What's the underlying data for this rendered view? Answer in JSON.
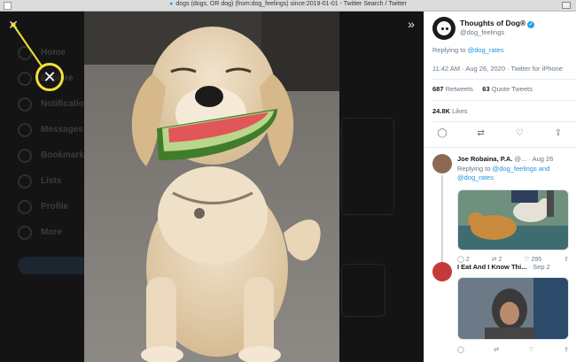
{
  "browser": {
    "tab_title": "dogs (dogs, OR dog) (from:dog_feelings) since:2019-01-01 - Twitter Search / Twitter"
  },
  "background_nav": {
    "items": [
      {
        "label": "Home",
        "icon": "home-icon"
      },
      {
        "label": "Explore",
        "icon": "hashtag-icon"
      },
      {
        "label": "Notifications",
        "icon": "bell-icon"
      },
      {
        "label": "Messages",
        "icon": "mail-icon"
      },
      {
        "label": "Bookmarks",
        "icon": "bookmark-icon"
      },
      {
        "label": "Lists",
        "icon": "list-icon"
      },
      {
        "label": "Profile",
        "icon": "user-icon"
      },
      {
        "label": "More",
        "icon": "more-icon"
      }
    ]
  },
  "viewer": {
    "close_glyph": "✕",
    "next_glyph": "»",
    "callout_glyph": "✕",
    "callout_color": "#f2e135"
  },
  "tweet": {
    "author_name": "Thoughts of Dog®",
    "author_handle": "@dog_feelings",
    "replying_prefix": "Replying to",
    "replying_handle": "@dog_rates",
    "timestamp": "11:42 AM · Aug 26, 2020 · Twitter for iPhone",
    "retweets_count": "687",
    "retweets_label": "Retweets",
    "quotes_count": "63",
    "quotes_label": "Quote Tweets",
    "likes_count": "24.8K",
    "likes_label": "Likes",
    "accent_color": "#1da1f2"
  },
  "replies": [
    {
      "name": "Joe Robaina, P.A.",
      "handle": "@...",
      "date": "Aug 26",
      "replying_prefix": "Replying to",
      "replying_handles": "@dog_feelings and @dog_rates",
      "reply_count": "2",
      "retweet_count": "2",
      "like_count": "295"
    },
    {
      "name": "I Eat And I Know Thi...",
      "handle": "",
      "date": "Sep 2",
      "reply_count": "",
      "retweet_count": "",
      "like_count": ""
    }
  ]
}
